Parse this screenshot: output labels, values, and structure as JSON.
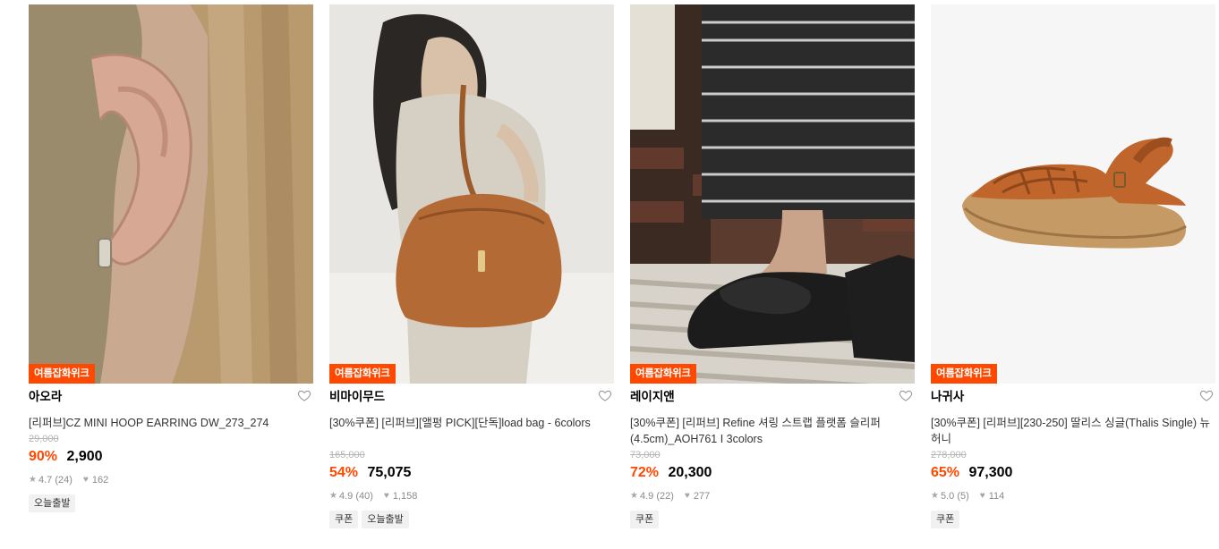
{
  "products": [
    {
      "badge": "여름잡화위크",
      "brand": "아오라",
      "title": "[리퍼브]CZ MINI HOOP EARRING DW_273_274",
      "original_price": "29,000",
      "discount": "90%",
      "price": "2,900",
      "rating": "4.7",
      "reviews": "(24)",
      "likes": "162",
      "tags": [
        "오늘출발"
      ]
    },
    {
      "badge": "여름잡화위크",
      "brand": "비마이무드",
      "title": "[30%쿠폰] [리퍼브][앨펑 PICK][단독]load bag - 6colors",
      "original_price": "165,000",
      "discount": "54%",
      "price": "75,075",
      "rating": "4.9",
      "reviews": "(40)",
      "likes": "1,158",
      "tags": [
        "쿠폰",
        "오늘출발"
      ]
    },
    {
      "badge": "여름잡화위크",
      "brand": "레이지앤",
      "title": "[30%쿠폰] [리퍼브] Refine 셔링 스트랩 플랫폼 슬리퍼 (4.5cm)_AOH761 I 3colors",
      "original_price": "73,000",
      "discount": "72%",
      "price": "20,300",
      "rating": "4.9",
      "reviews": "(22)",
      "likes": "277",
      "tags": [
        "쿠폰"
      ]
    },
    {
      "badge": "여름잡화위크",
      "brand": "나귀사",
      "title": "[30%쿠폰] [리퍼브][230-250] 딸리스 싱글(Thalis Single) 뉴허니",
      "original_price": "278,000",
      "discount": "65%",
      "price": "97,300",
      "rating": "5.0",
      "reviews": "(5)",
      "likes": "114",
      "tags": [
        "쿠폰"
      ]
    }
  ],
  "icons": {
    "like": "heart-outline-icon",
    "rating": "star-icon",
    "likes": "heart-filled-icon"
  },
  "colors": {
    "accent": "#ff4800",
    "strike": "#b5b5b5",
    "tag_bg": "#f1f1f1"
  }
}
